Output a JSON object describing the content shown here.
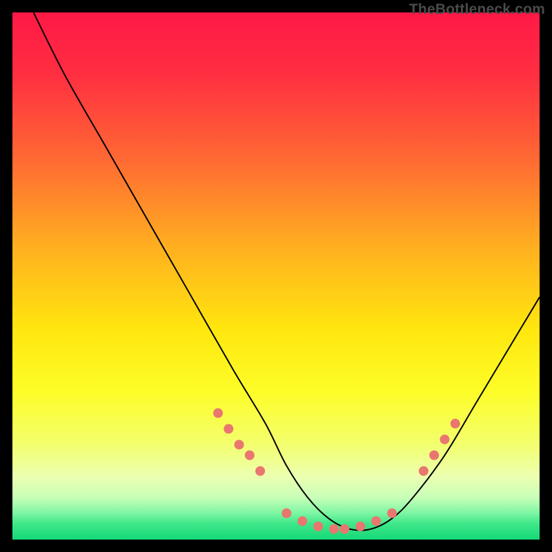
{
  "watermark": "TheBottleneck.com",
  "chart_data": {
    "type": "line",
    "title": "",
    "xlabel": "",
    "ylabel": "",
    "xlim": [
      0,
      100
    ],
    "ylim": [
      0,
      100
    ],
    "grid": false,
    "legend": false,
    "background_gradient": {
      "stops": [
        {
          "pct": 0,
          "color": "#ff1846"
        },
        {
          "pct": 12,
          "color": "#ff2f41"
        },
        {
          "pct": 28,
          "color": "#ff6a33"
        },
        {
          "pct": 45,
          "color": "#ffb11f"
        },
        {
          "pct": 60,
          "color": "#ffe60e"
        },
        {
          "pct": 72,
          "color": "#fdfd28"
        },
        {
          "pct": 82,
          "color": "#f3ff6e"
        },
        {
          "pct": 88,
          "color": "#ecffb0"
        },
        {
          "pct": 92,
          "color": "#c8ffb8"
        },
        {
          "pct": 95,
          "color": "#7cf6a2"
        },
        {
          "pct": 97,
          "color": "#3fe789"
        },
        {
          "pct": 100,
          "color": "#14d877"
        }
      ]
    },
    "series": [
      {
        "name": "bottleneck-curve",
        "color": "#000000",
        "width": 2,
        "x": [
          4,
          10,
          18,
          26,
          34,
          42,
          48,
          52,
          56,
          60,
          64,
          68,
          72,
          76,
          82,
          88,
          94,
          100
        ],
        "values": [
          100,
          88,
          74,
          60,
          46,
          32,
          22,
          14,
          8,
          4,
          2,
          2,
          4,
          8,
          16,
          26,
          36,
          46
        ]
      }
    ],
    "markers": {
      "name": "highlight-dots",
      "color": "#e9766f",
      "radius": 7,
      "points": [
        {
          "x": 39,
          "y": 24
        },
        {
          "x": 41,
          "y": 21
        },
        {
          "x": 43,
          "y": 18
        },
        {
          "x": 45,
          "y": 16
        },
        {
          "x": 47,
          "y": 13
        },
        {
          "x": 52,
          "y": 5
        },
        {
          "x": 55,
          "y": 3.5
        },
        {
          "x": 58,
          "y": 2.5
        },
        {
          "x": 61,
          "y": 2
        },
        {
          "x": 63,
          "y": 2
        },
        {
          "x": 66,
          "y": 2.5
        },
        {
          "x": 69,
          "y": 3.5
        },
        {
          "x": 72,
          "y": 5
        },
        {
          "x": 78,
          "y": 13
        },
        {
          "x": 80,
          "y": 16
        },
        {
          "x": 82,
          "y": 19
        },
        {
          "x": 84,
          "y": 22
        }
      ]
    }
  }
}
